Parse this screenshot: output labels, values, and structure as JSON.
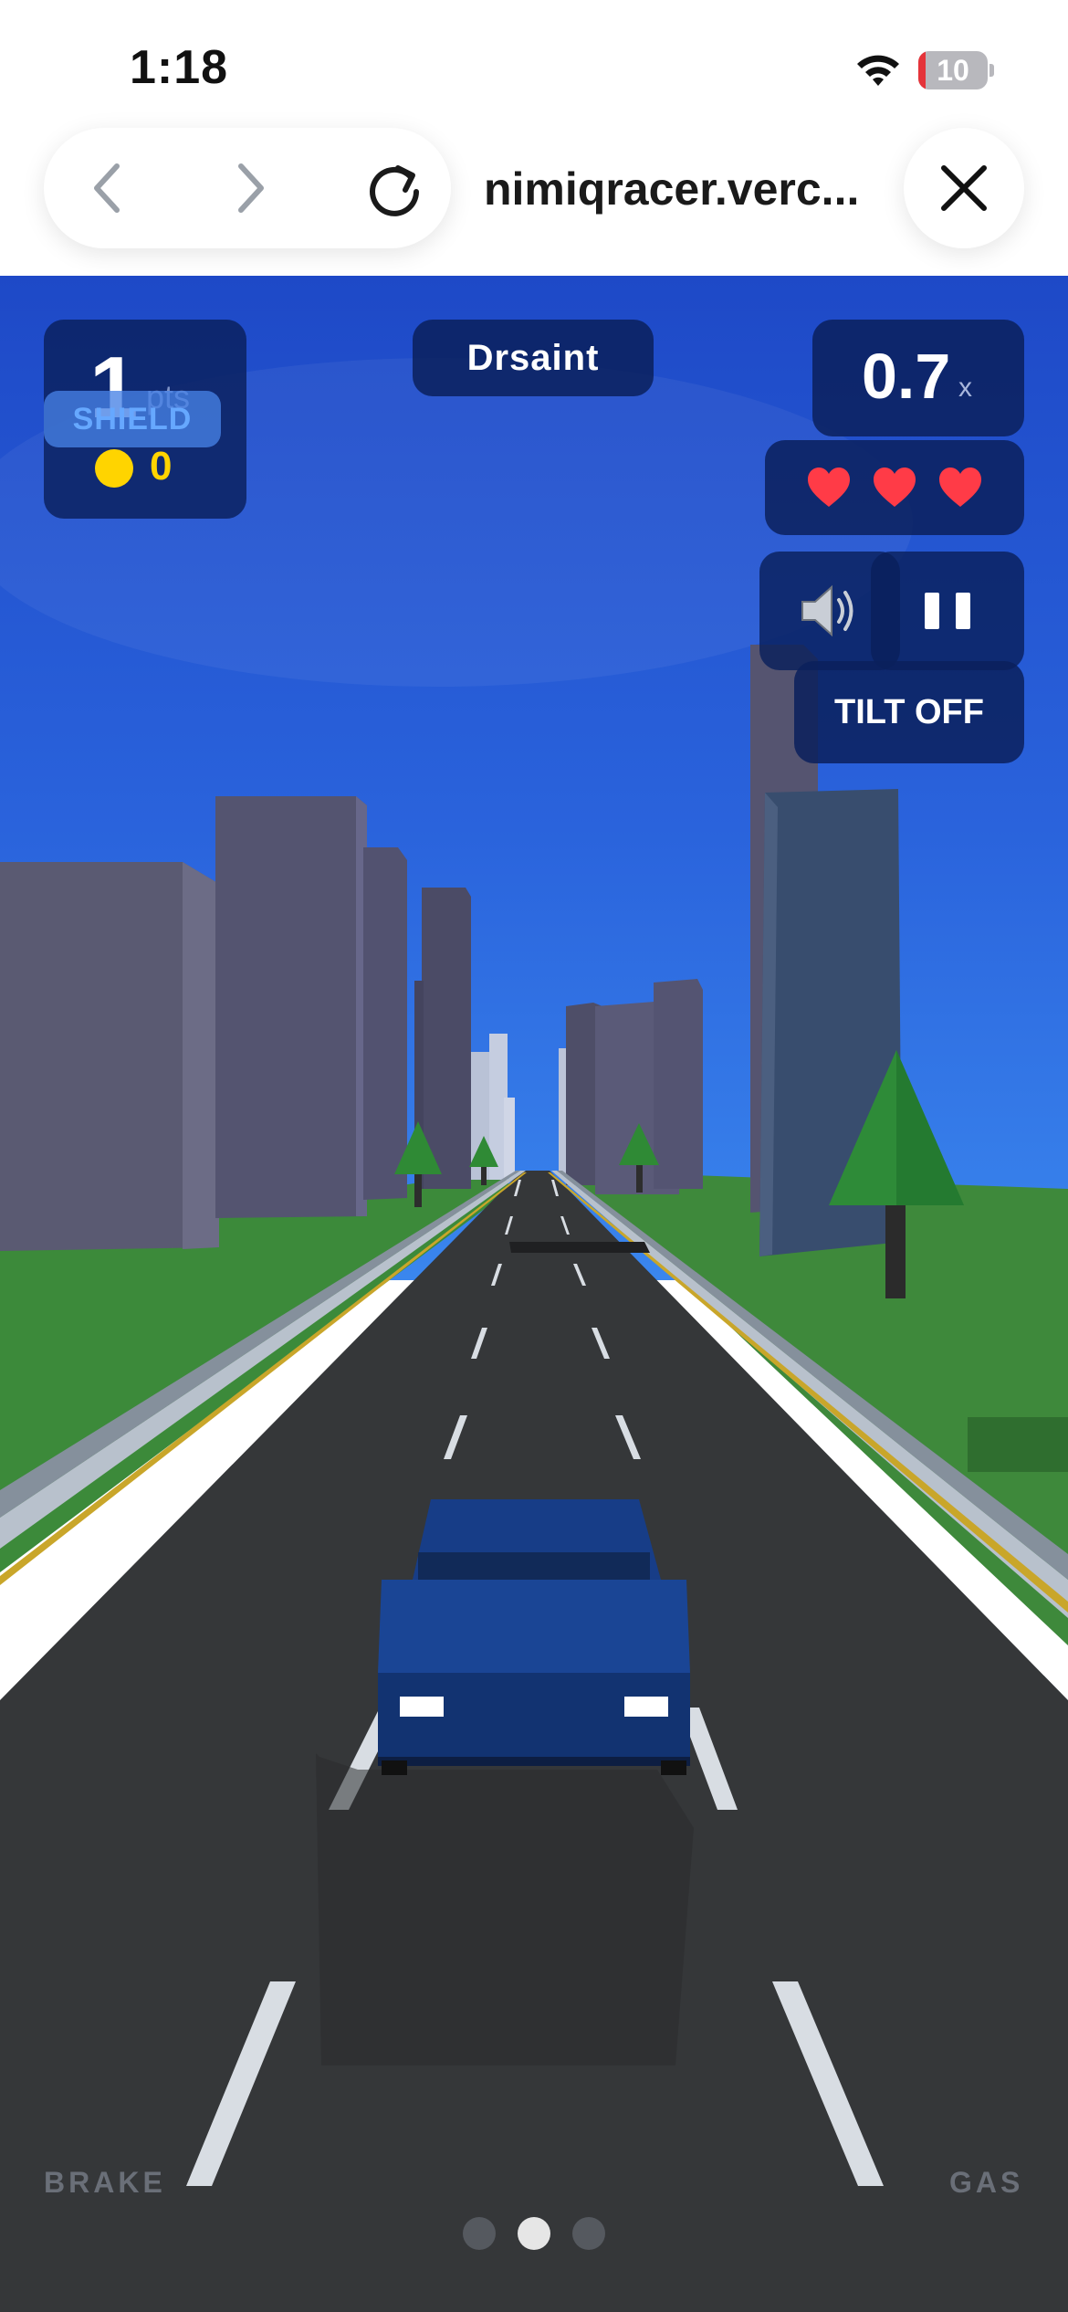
{
  "status_bar": {
    "time": "1:18",
    "battery_level": "10",
    "battery_fraction": 0.1,
    "icons": [
      "wifi-icon",
      "battery-icon"
    ]
  },
  "browser": {
    "url": "nimiqracer.verc...",
    "back_icon": "chevron-left-icon",
    "forward_icon": "chevron-right-icon",
    "reload_icon": "reload-icon",
    "close_icon": "close-icon"
  },
  "hud": {
    "score": "1",
    "score_unit": "pts",
    "shield_label": "SHIELD",
    "coins": "0",
    "player_name": "Drsaint",
    "speed_multiplier": "0.7",
    "speed_unit": "x",
    "lives": 3,
    "sound_icon": "speaker-icon",
    "pause_icon": "pause-icon",
    "tilt_label": "TILT OFF"
  },
  "controls": {
    "brake_label": "BRAKE",
    "gas_label": "GAS"
  },
  "pagination": {
    "count": 3,
    "active_index": 1
  },
  "colors": {
    "hud_panel": "#0a205c",
    "coin": "#ffd400",
    "heart": "#ff3b47",
    "shield": "#66a8ff",
    "sky": "#2f6fe0",
    "grass": "#3c8a3a",
    "road": "#35373a",
    "car": "#173c86"
  }
}
